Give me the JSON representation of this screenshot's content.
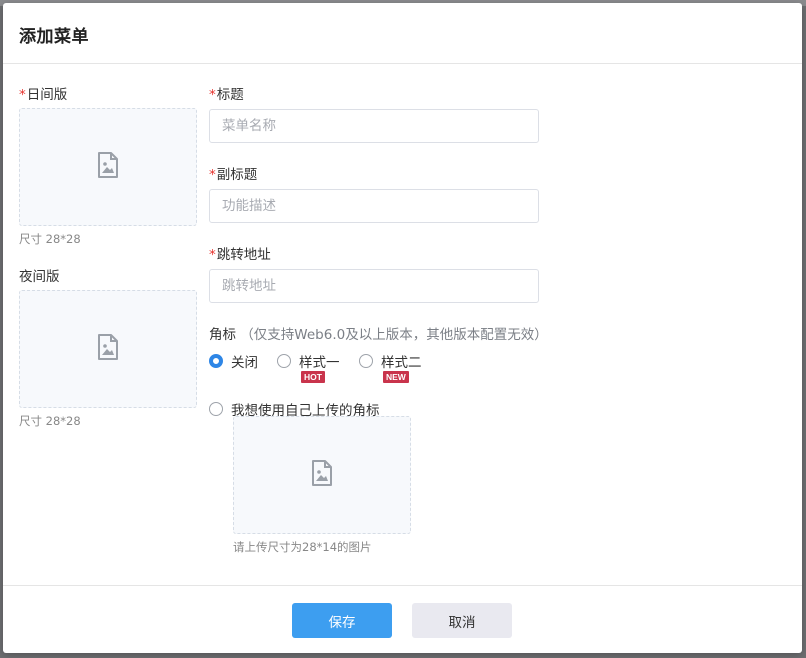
{
  "dialog": {
    "title": "添加菜单"
  },
  "left": {
    "day": {
      "label": "日间版",
      "size_hint": "尺寸 28*28"
    },
    "night": {
      "label": "夜间版",
      "size_hint": "尺寸 28*28"
    },
    "required_mark": "*"
  },
  "form": {
    "title": {
      "label": "标题",
      "placeholder": "菜单名称"
    },
    "subtitle": {
      "label": "副标题",
      "placeholder": "功能描述"
    },
    "url": {
      "label": "跳转地址",
      "placeholder": "跳转地址"
    },
    "badge": {
      "label": "角标",
      "note": "（仅支持Web6.0及以上版本，其他版本配置无效）",
      "options": [
        {
          "label": "关闭",
          "checked": true
        },
        {
          "label": "样式一",
          "tag": "HOT",
          "checked": false
        },
        {
          "label": "样式二",
          "tag": "NEW",
          "checked": false
        },
        {
          "label": "我想使用自己上传的角标",
          "checked": false
        }
      ],
      "upload_hint": "请上传尺寸为28*14的图片"
    }
  },
  "footer": {
    "save_label": "保存",
    "cancel_label": "取消"
  },
  "colors": {
    "primary": "#3d9ef0",
    "required": "#e5322d",
    "tag": "#c9344c",
    "radio_checked": "#2e86e6"
  },
  "icons": {
    "upload_placeholder": "image-file-icon"
  }
}
